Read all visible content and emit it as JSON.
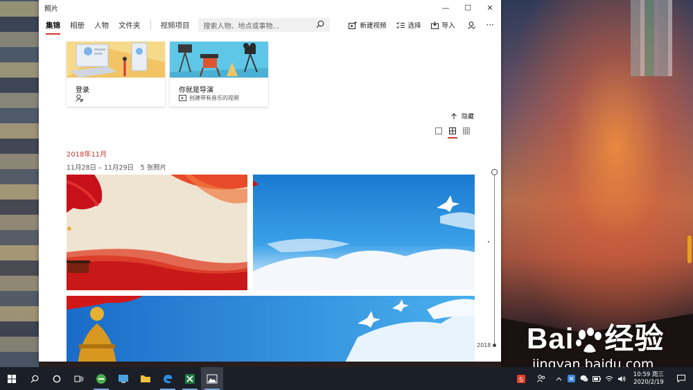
{
  "window": {
    "title": "照片",
    "controls": {
      "minimize": "—",
      "maximize": "☐",
      "close": "✕"
    }
  },
  "toolbar": {
    "tabs": [
      "集锦",
      "相册",
      "人物",
      "文件夹"
    ],
    "video_project": "视频项目",
    "search_placeholder": "搜索人物、地点或事物...",
    "new_video": "新建视频",
    "select": "选择",
    "import": "导入",
    "more": "···"
  },
  "cards": [
    {
      "title": "登录",
      "icon": "person-sign-in-icon",
      "subtitle": ""
    },
    {
      "title": "你就是导演",
      "icon": "video-icon",
      "subtitle": "创建带有音乐的视频"
    }
  ],
  "collection": {
    "hide_label": "隐藏",
    "month": "2018年11月",
    "range": "11月28日 – 11月29日　5 张照片",
    "timeline_year": "2018"
  },
  "watermark": {
    "brand": "Bai",
    "brand_suffix": "经验",
    "url": "jingyan.baidu.com"
  },
  "taskbar": {
    "time": "10:59 周三",
    "date": "2020/2/19"
  },
  "colors": {
    "accent": "#d13438",
    "taskbar": "#1b1f27"
  }
}
